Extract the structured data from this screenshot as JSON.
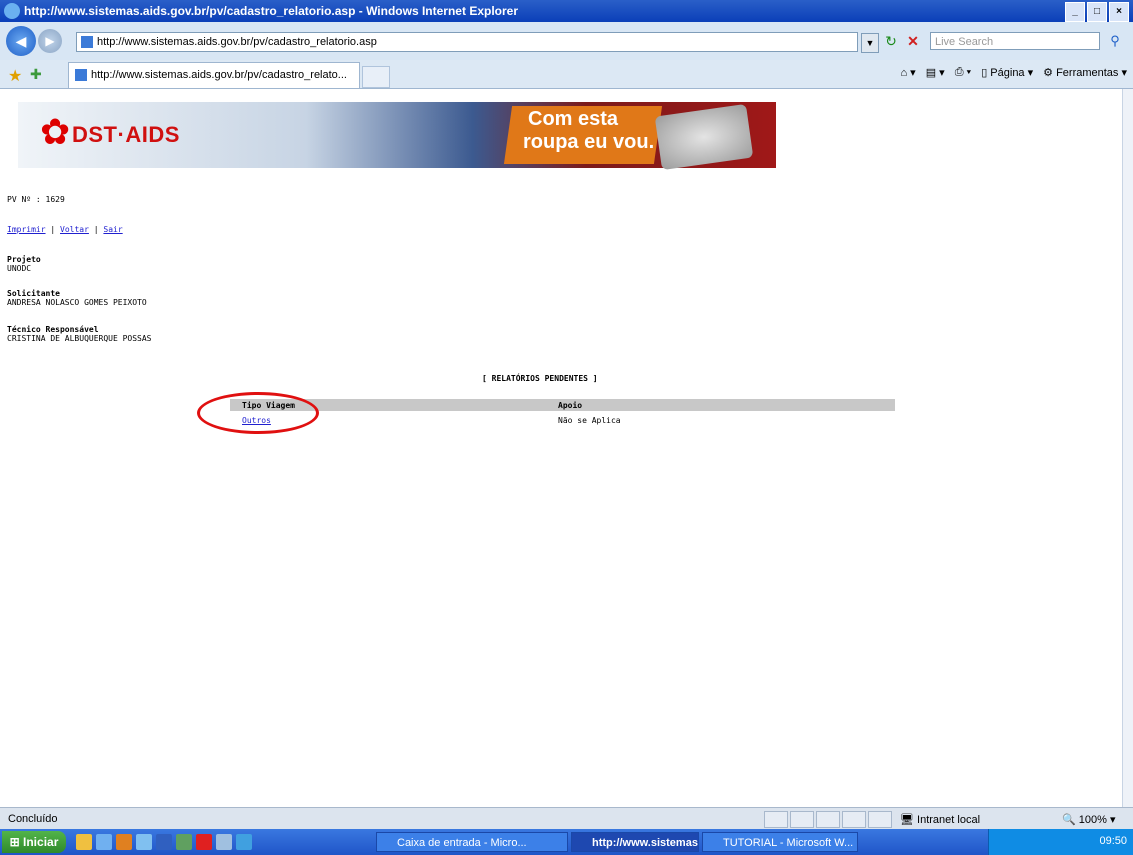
{
  "window": {
    "title": "http://www.sistemas.aids.gov.br/pv/cadastro_relatorio.asp - Windows Internet Explorer"
  },
  "nav": {
    "address": "http://www.sistemas.aids.gov.br/pv/cadastro_relatorio.asp",
    "search_placeholder": "Live Search"
  },
  "tab": {
    "label": "http://www.sistemas.aids.gov.br/pv/cadastro_relato..."
  },
  "cmdbar": {
    "page": "Página",
    "tools": "Ferramentas"
  },
  "banner": {
    "logo": "DST·AIDS",
    "slogan_line1": "Com esta",
    "slogan_line2": "roupa eu vou."
  },
  "page": {
    "pv_label": "PV Nº : 1629",
    "links": {
      "print": "Imprimir",
      "back": "Voltar",
      "exit": "Sair",
      "sep": "|"
    },
    "projeto_label": "Projeto",
    "projeto_value": "UNODC",
    "solicitante_label": "Solicitante",
    "solicitante_value": "ANDRESA NOLASCO GOMES PEIXOTO",
    "tecnico_label": "Técnico Responsável",
    "tecnico_value": "CRISTINA DE ALBUQUERQUE POSSAS",
    "section_title": "[ RELATÓRIOS PENDENTES ]",
    "table": {
      "col1": "Tipo Viagem",
      "col2": "Apoio",
      "row1_col1": "Outros",
      "row1_col2": "Não se Aplica"
    }
  },
  "status": {
    "text": "Concluído",
    "zone": "Intranet local",
    "zoom": "100%"
  },
  "taskbar": {
    "start": "Iniciar",
    "btn1": "Caixa de entrada - Micro...",
    "btn2": "http://www.sistemas....",
    "btn3": "TUTORIAL - Microsoft W...",
    "clock": "09:50"
  }
}
